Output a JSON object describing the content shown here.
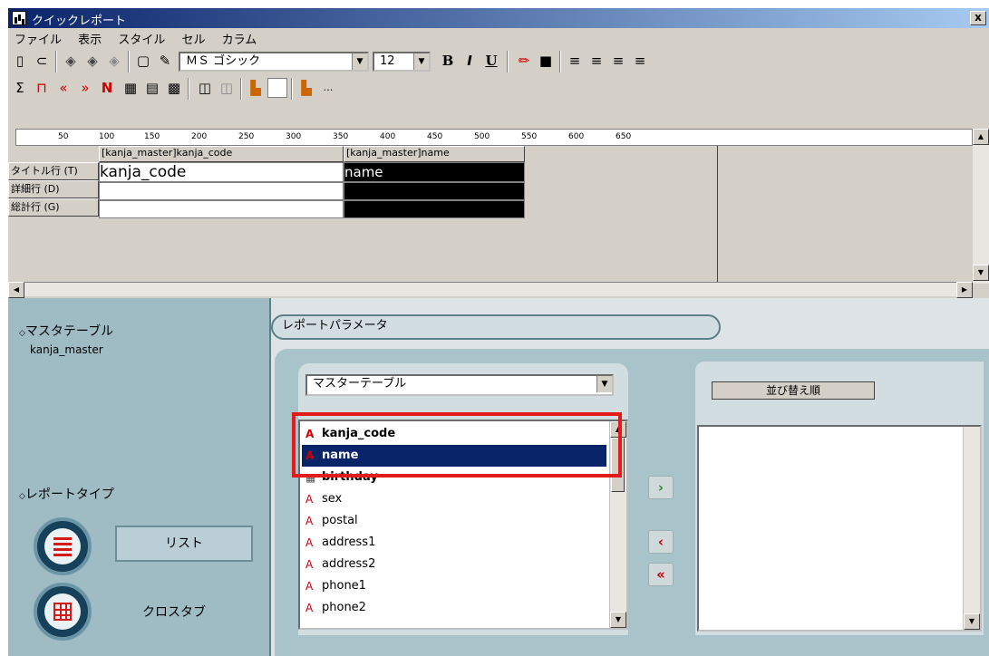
{
  "window": {
    "title": "クイックレポート",
    "close": "x"
  },
  "menu": [
    "ファイル",
    "表示",
    "スタイル",
    "セル",
    "カラム"
  ],
  "toolbar": {
    "font_name": "ＭＳ ゴシック",
    "font_size": "12",
    "bold": "B",
    "italic": "I",
    "underline": "U"
  },
  "ruler": [
    "50",
    "100",
    "150",
    "200",
    "250",
    "300",
    "350",
    "400",
    "450",
    "500",
    "550",
    "600",
    "650"
  ],
  "grid": {
    "columns": [
      {
        "header": "[kanja_master]kanja_code",
        "title": "kanja_code"
      },
      {
        "header": "[kanja_master]name",
        "title": "name"
      }
    ],
    "rows": [
      "タイトル行 (T)",
      "詳細行 (D)",
      "総計行 (G)"
    ]
  },
  "left_panel": {
    "master_label": "マスタテーブル",
    "master_value": "kanja_master",
    "report_type_label": "レポートタイプ",
    "type_list": "リスト",
    "type_cross": "クロスタブ"
  },
  "params": {
    "tab_label": "レポートパラメータ",
    "dropdown_value": "マスターテーブル",
    "fields": [
      "kanja_code",
      "name",
      "birthday",
      "sex",
      "postal",
      "address1",
      "address2",
      "phone1",
      "phone2"
    ],
    "selected_field": "name",
    "sort_label": "並び替え順"
  },
  "colors": {
    "accent_red": "#e41b1b",
    "selection": "#0a246a"
  }
}
